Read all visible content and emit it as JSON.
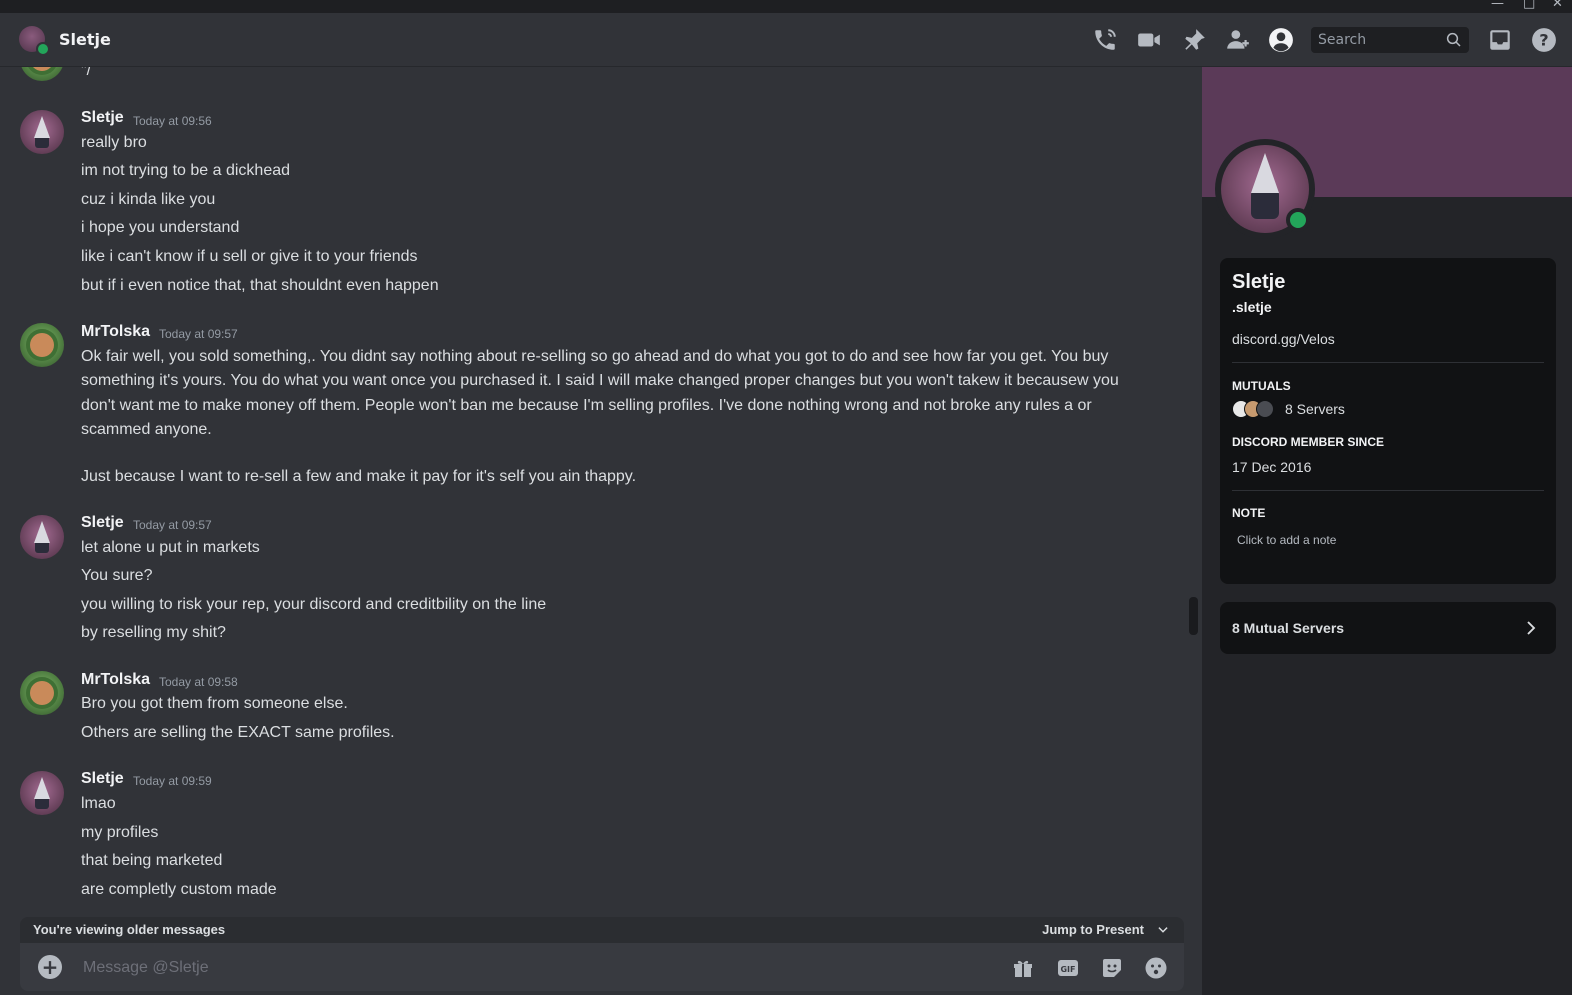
{
  "header": {
    "title": "Sletje",
    "search_placeholder": "Search"
  },
  "messages": [
    {
      "type": "fragment",
      "text": "\"/"
    },
    {
      "author": "Sletje",
      "timestamp": "Today at 09:56",
      "lines": [
        "really bro",
        "im not trying to be a dickhead",
        "cuz i kinda like you",
        "i hope you understand",
        "like i can't know if u sell or give it to your friends",
        "but if i even notice that, that shouldnt even happen"
      ]
    },
    {
      "author": "MrTolska",
      "timestamp": "Today at 09:57",
      "paragraph1": "Ok fair well, you sold something,. You didnt say nothing about re-selling so go ahead and do what you got to do and see how far you get. You buy something it's yours. You do what you want once you purchased it. I said I will make changed proper changes but you won't takew it becausew you don't want me to make money off them. People won't ban me because I'm selling profiles. I've done nothing wrong and not broke any rules a or scammed anyone.",
      "paragraph2": "Just because I want to re-sell a few and make it pay for it's self you ain thappy."
    },
    {
      "author": "Sletje",
      "timestamp": "Today at 09:57",
      "lines": [
        "let alone u put in markets",
        "You sure?",
        "you willing to risk your rep, your discord and creditbility on the line",
        "by reselling my shit?"
      ]
    },
    {
      "author": "MrTolska",
      "timestamp": "Today at 09:58",
      "lines": [
        "Bro you got them from someone else.",
        "Others are selling the EXACT same profiles."
      ]
    },
    {
      "author": "Sletje",
      "timestamp": "Today at 09:59",
      "lines": [
        "lmao",
        "my profiles",
        "that being marketed",
        "are completly custom made"
      ]
    }
  ],
  "older_bar": {
    "text": "You're viewing older messages",
    "jump_label": "Jump to Present"
  },
  "composer": {
    "placeholder": "Message @Sletje"
  },
  "profile": {
    "display_name": "Sletje",
    "username": ".sletje",
    "link": "discord.gg/Velos",
    "mutuals_label": "MUTUALS",
    "mutuals_value": "8 Servers",
    "member_since_label": "DISCORD MEMBER SINCE",
    "member_since_value": "17 Dec 2016",
    "note_label": "NOTE",
    "note_placeholder": "Click to add a note",
    "mutual_servers_button": "8 Mutual Servers",
    "banner_color": "#5b3a58",
    "status_color": "#23a55a"
  }
}
